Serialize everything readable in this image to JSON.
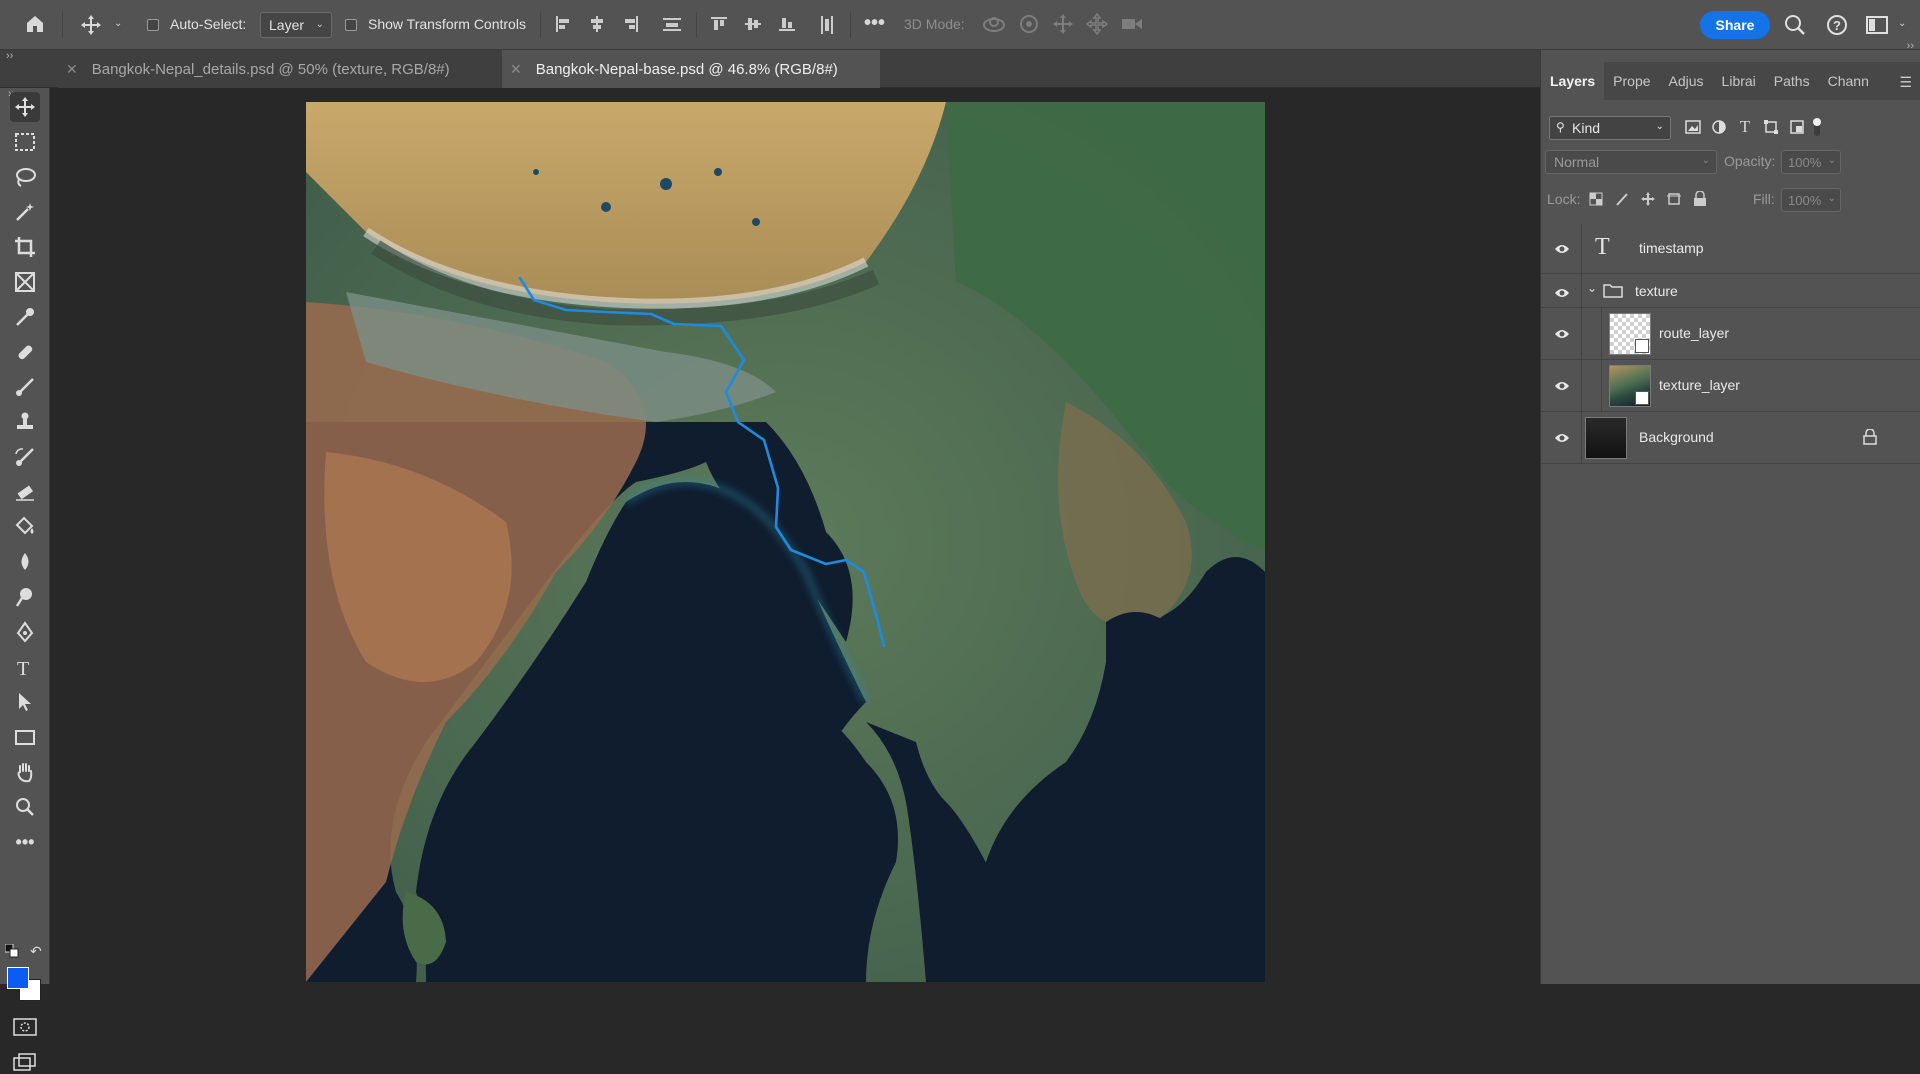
{
  "options_bar": {
    "auto_select_label": "Auto-Select:",
    "auto_select_value": "Layer",
    "show_transform_label": "Show Transform Controls",
    "mode_3d_label": "3D Mode:",
    "share_label": "Share"
  },
  "tabs": [
    {
      "label": "Bangkok-Nepal_details.psd @ 50% (texture, RGB/8#)",
      "active": false
    },
    {
      "label": "Bangkok-Nepal-base.psd @ 46.8% (RGB/8#)",
      "active": true
    }
  ],
  "panel": {
    "tabs": [
      "Layers",
      "Prope",
      "Adjus",
      "Librai",
      "Paths",
      "Chann"
    ],
    "filter_kind": "Kind",
    "blend_mode": "Normal",
    "opacity_label": "Opacity:",
    "opacity_value": "100%",
    "lock_label": "Lock:",
    "fill_label": "Fill:",
    "fill_value": "100%",
    "layers": [
      {
        "name": "timestamp",
        "type": "text"
      },
      {
        "name": "texture",
        "type": "group"
      },
      {
        "name": "route_layer",
        "type": "smart-object"
      },
      {
        "name": "texture_layer",
        "type": "smart-object"
      },
      {
        "name": "Background",
        "type": "background",
        "locked": true
      }
    ]
  },
  "colors": {
    "foreground": "#0a5cf5",
    "background": "#ffffff",
    "route": "#1e8be0",
    "accent": "#1473e6"
  }
}
